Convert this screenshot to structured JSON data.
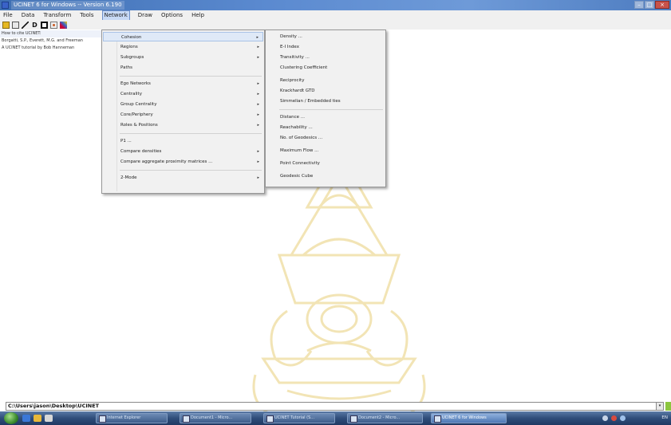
{
  "window": {
    "title": "UCINET 6 for Windows -- Version 6.190"
  },
  "menubar": {
    "items": [
      "File",
      "Data",
      "Transform",
      "Tools",
      "Network",
      "Draw",
      "Options",
      "Help"
    ],
    "active": "Network"
  },
  "toolbar": {
    "icons": [
      "open-folder-icon",
      "matrix-editor-icon",
      "line-tool-icon",
      "d-letter-icon",
      "network-icon",
      "graph-icon",
      "netdraw-icon"
    ]
  },
  "log": {
    "lines": [
      "How to cite UCINET:",
      "Borgatti, S.P., Everett, M.G. and Freeman",
      "A UCINET tutorial by Bob Hanneman"
    ]
  },
  "network_menu": {
    "items": [
      {
        "label": "Cohesion",
        "submenu": true
      },
      {
        "label": "Regions",
        "submenu": true
      },
      {
        "label": "Subgroups",
        "submenu": true
      },
      {
        "label": "Paths",
        "submenu": false
      },
      {
        "label": "Ego Networks",
        "submenu": true
      },
      {
        "label": "Centrality",
        "submenu": true
      },
      {
        "label": "Group Centrality",
        "submenu": true
      },
      {
        "label": "Core/Periphery",
        "submenu": true
      },
      {
        "label": "Roles & Positions",
        "submenu": true
      },
      {
        "label": "P1 ...",
        "submenu": false
      },
      {
        "label": "Compare densities",
        "submenu": true
      },
      {
        "label": "Compare aggregate proximity matrices ...",
        "submenu": true
      },
      {
        "label": "2-Mode",
        "submenu": true
      }
    ],
    "highlighted": "Cohesion",
    "arrow": "▸"
  },
  "cohesion_menu": {
    "items": [
      "Density ...",
      "E-I Index",
      "Transitivity ...",
      "Clustering Coefficient",
      "Reciprocity",
      "Krackhardt GTD",
      "Simmelian / Embedded ties",
      "Distance ...",
      "Reachability ...",
      "No. of Geodesics ...",
      "Maximum Flow ...",
      "Point Connectivity",
      "Geodesic Cube"
    ]
  },
  "pathbar": {
    "path": "C:\\Users\\jason\\Desktop\\UCINET",
    "dropdown": "▾"
  },
  "taskbar": {
    "tasks": [
      {
        "label": "Internet Explorer",
        "active": false
      },
      {
        "label": "Document1 - Micro...",
        "active": false
      },
      {
        "label": "UCINET Tutorial (S...",
        "active": false
      },
      {
        "label": "Document2 - Micro...",
        "active": false
      },
      {
        "label": "UCINET 6 for Windows",
        "active": true
      }
    ],
    "tray_text": "EN"
  },
  "colors": {
    "titlebar": "#4d7cc0",
    "menu_highlight": "#dfe9f7",
    "taskbar": "#2f4d7a",
    "watermark_gold": "#e6c76a"
  }
}
